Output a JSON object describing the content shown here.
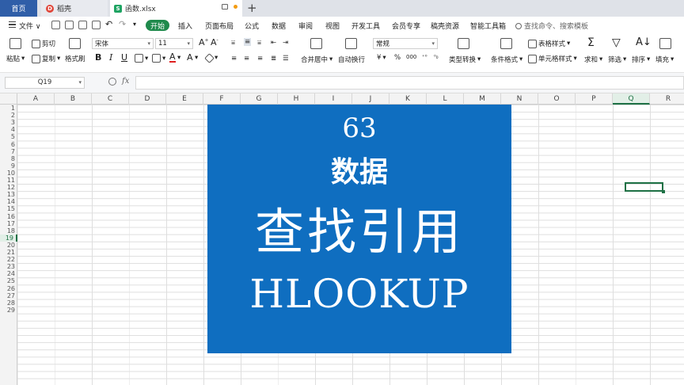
{
  "tabs": {
    "home": "首页",
    "daoke": "稻壳",
    "file": "函数.xlsx",
    "add": "+"
  },
  "menu": {
    "file": "文件",
    "items": [
      "开始",
      "插入",
      "页面布局",
      "公式",
      "数据",
      "审阅",
      "视图",
      "开发工具",
      "会员专享",
      "稿壳资源",
      "智能工具箱"
    ],
    "search_placeholder": "查找命令、搜索模板"
  },
  "ribbon": {
    "paste": "粘贴",
    "cut": "剪切",
    "copy": "复制",
    "format_painter": "格式刷",
    "font_name": "宋体",
    "font_size": "11",
    "merge_center": "合并居中",
    "wrap_text": "自动换行",
    "number_format": "常规",
    "type_convert": "类型转换",
    "conditional_format": "条件格式",
    "table_style": "表格样式",
    "cell_style": "单元格样式",
    "sum": "求和",
    "filter": "筛选",
    "sort": "排序",
    "fill": "填充",
    "currency": "¥",
    "percent": "%",
    "thousands": "000"
  },
  "formula_bar": {
    "cell_ref": "Q19",
    "fx": "fx",
    "value": ""
  },
  "grid": {
    "columns": [
      "A",
      "B",
      "C",
      "D",
      "E",
      "F",
      "G",
      "H",
      "I",
      "J",
      "K",
      "L",
      "M",
      "N",
      "O",
      "P",
      "Q",
      "R"
    ],
    "rows": [
      "1",
      "2",
      "3",
      "4",
      "5",
      "6",
      "7",
      "8",
      "9",
      "10",
      "11",
      "12",
      "13",
      "14",
      "15",
      "16",
      "17",
      "18",
      "19",
      "20",
      "21",
      "22",
      "23",
      "24",
      "25",
      "26",
      "27",
      "28",
      "29"
    ],
    "selected_column": "Q",
    "selected_row": "19"
  },
  "title_block": {
    "number": "63",
    "line2": "数据",
    "line3": "查找引用",
    "line4": "HLOOKUP",
    "background": "#0f6ec0"
  },
  "colors": {
    "accent": "#1e7145",
    "home_tab": "#2f5ea8",
    "start_pill": "#1f8a4c"
  }
}
